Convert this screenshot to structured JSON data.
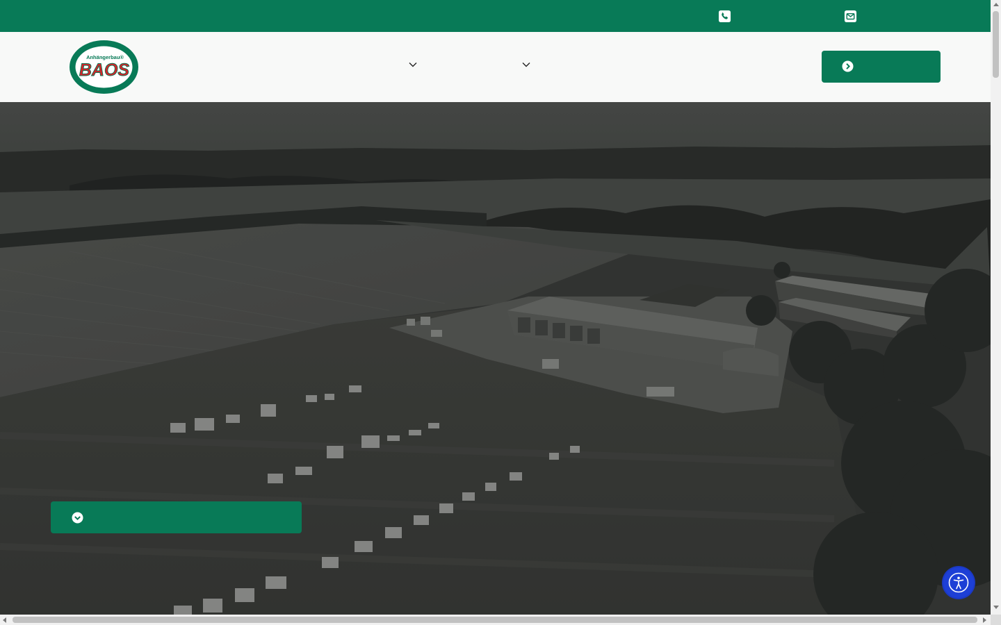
{
  "colors": {
    "brand": "#087a57",
    "logo_red": "#d6232a",
    "accessibility_button": "#1d3fd6"
  },
  "topbar": {
    "phone_icon": "phone-icon",
    "mail_icon": "envelope-icon"
  },
  "header": {
    "logo": {
      "small_text": "Anhängerbau®",
      "big_text": "BAOS"
    },
    "nav_dropdown_icons": [
      "chevron-down-icon",
      "chevron-down-icon"
    ],
    "cta": {
      "icon": "circle-chevron-right-icon",
      "label": ""
    }
  },
  "hero": {
    "cta": {
      "icon": "circle-chevron-down-icon",
      "label": ""
    }
  },
  "accessibility": {
    "icon": "accessibility-person-icon"
  }
}
